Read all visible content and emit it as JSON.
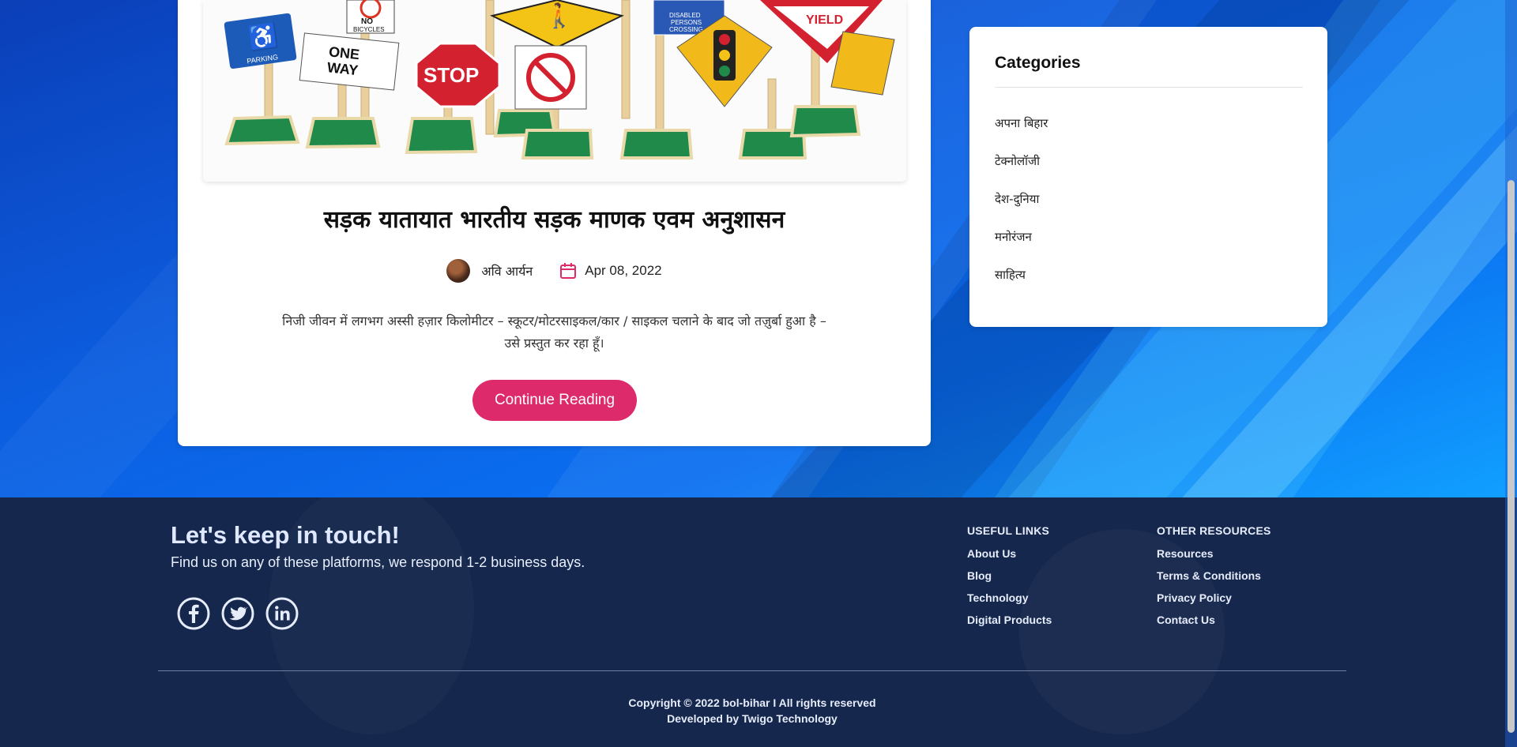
{
  "post": {
    "title": "सड़क यातायात भारतीय सड़क माणक एवम अनुशासन",
    "author": "अवि आर्यन",
    "date": "Apr 08, 2022",
    "excerpt": "निजी जीवन में लगभग अस्सी हज़ार किलोमीटर – स्कूटर/मोटरसाइकल/कार / साइकल चलाने के बाद जो तज़ुर्बा हुआ है – उसे प्रस्तुत कर रहा हूँ।",
    "continue_label": "Continue Reading",
    "image_signs": {
      "parking": "PARKING",
      "no_bicycles_1": "NO",
      "no_bicycles_2": "BICYCLES",
      "one_way_1": "ONE",
      "one_way_2": "WAY",
      "stop": "STOP",
      "yield": "YIELD",
      "disabled_1": "DISABLED",
      "disabled_2": "PERSONS",
      "disabled_3": "CROSSING"
    }
  },
  "categories": {
    "title": "Categories",
    "items": [
      "अपना बिहार",
      "टेक्नोलॉजी",
      "देश-दुनिया",
      "मनोरंजन",
      "साहित्य"
    ]
  },
  "footer": {
    "title": "Let's keep in touch!",
    "subtitle": "Find us on any of these platforms, we respond 1-2 business days.",
    "social_icons": [
      "facebook-icon",
      "twitter-icon",
      "linkedin-icon"
    ],
    "useful_links": {
      "heading": "USEFUL LINKS",
      "items": [
        "About Us",
        "Blog",
        "Technology",
        "Digital Products"
      ]
    },
    "other_resources": {
      "heading": "OTHER RESOURCES",
      "items": [
        "Resources",
        "Terms & Conditions",
        "Privacy Policy",
        "Contact Us"
      ]
    },
    "copyright": "Copyright © 2022 bol-bihar I All rights reserved",
    "developed_by": "Developed by Twigo Technology"
  },
  "colors": {
    "accent": "#dd2a6a",
    "footer_bg": "#15274c",
    "background": "#0a56d8"
  }
}
